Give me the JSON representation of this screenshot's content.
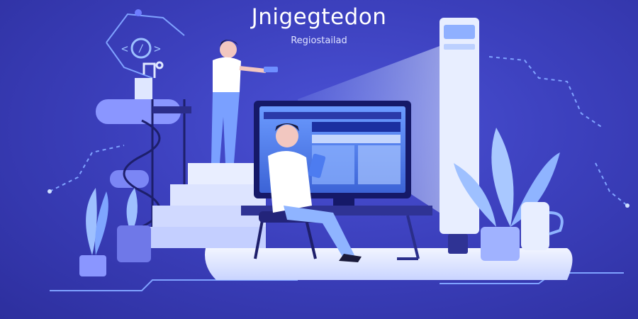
{
  "header": {
    "title": "Jnigegtedon",
    "subtitle": "Regiostailad"
  },
  "scene": {
    "icons": [
      "code-icon",
      "robot-arm-icon",
      "tablet-icon",
      "document-icon"
    ],
    "colors": {
      "background": "#3b3fb8",
      "accent": "#8fb4ff",
      "light": "#e7ecff",
      "plant": "#9ec0ff",
      "screen": "#5d8cf5"
    }
  }
}
